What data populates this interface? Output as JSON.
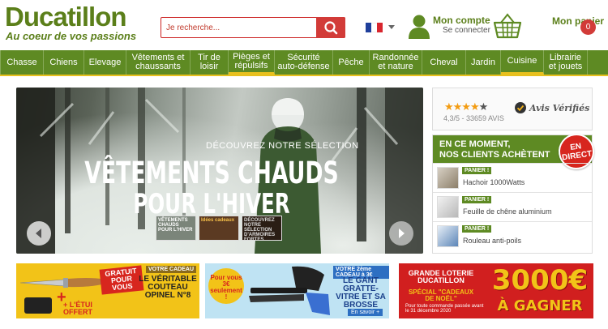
{
  "brand": {
    "name": "Ducatillon",
    "tagline": "Au coeur de vos passions",
    "color": "#5b7f1a"
  },
  "search": {
    "placeholder": "Je recherche..."
  },
  "account": {
    "title": "Mon compte",
    "subtitle": "Se connecter",
    "icon": "user-icon"
  },
  "cart": {
    "title": "Mon panier",
    "count": "0",
    "icon": "basket-icon"
  },
  "nav": [
    {
      "label": "Chasse"
    },
    {
      "label": "Chiens"
    },
    {
      "label": "Elevage"
    },
    {
      "label": "Vêtements et chaussants"
    },
    {
      "label": "Tir de loisir"
    },
    {
      "label": "Pièges et répulsifs"
    },
    {
      "label": "Sécurité auto-défense"
    },
    {
      "label": "Pêche"
    },
    {
      "label": "Randonnée et nature"
    },
    {
      "label": "Cheval"
    },
    {
      "label": "Jardin"
    },
    {
      "label": "Cuisine"
    },
    {
      "label": "Librairie et jouets"
    }
  ],
  "hero": {
    "kicker": "DÉCOUVREZ NOTRE SÉLECTION",
    "title_line1": "VÊTEMENTS CHAUDS",
    "title_line2": "POUR L'HIVER",
    "thumbs": [
      {
        "label": "VÊTEMENTS CHAUDS POUR L'HIVER"
      },
      {
        "label": "Idées cadeaux"
      },
      {
        "label": "DÉCOUVREZ NOTRE SÉLECTION D'ARMOIRES FORTES"
      }
    ]
  },
  "reviews": {
    "rating": "4,3/5 - 33659 AVIS",
    "stars_filled": 4,
    "stars_total": 5,
    "brand": "Avis Vérifiés"
  },
  "live": {
    "title_line1": "EN CE MOMENT,",
    "title_line2": "NOS CLIENTS ACHÈTENT",
    "badge_line1": "EN",
    "badge_line2": "DIRECT",
    "items": [
      {
        "tag": "PANIER !",
        "name": "Hachoir 1000Watts"
      },
      {
        "tag": "PANIER !",
        "name": "Feuille de chêne aluminium"
      },
      {
        "tag": "PANIER !",
        "name": "Rouleau anti-poils"
      }
    ]
  },
  "banners": [
    {
      "label_a": "GRATUIT POUR VOUS",
      "label_b": "VOTRE CADEAU",
      "label_c": "LE VÉRITABLE COUTEAU OPINEL N°8",
      "label_d": "+ L'ÉTUI OFFERT"
    },
    {
      "label_a": "Pour vous 3€ seulement !",
      "label_b": "VOTRE 2ème CADEAU à 3€",
      "label_c": "LE GANT GRATTE-VITRE ET SA BROSSE",
      "label_d": "En savoir +"
    },
    {
      "label_a": "GRANDE LOTERIE DUCATILLON",
      "label_b": "SPÉCIAL \"CADEAUX DE NOËL\"",
      "label_c": "3000€",
      "label_d": "À GAGNER",
      "label_e": "Pour toute commande passée avant le 31 décembre 2020"
    }
  ]
}
